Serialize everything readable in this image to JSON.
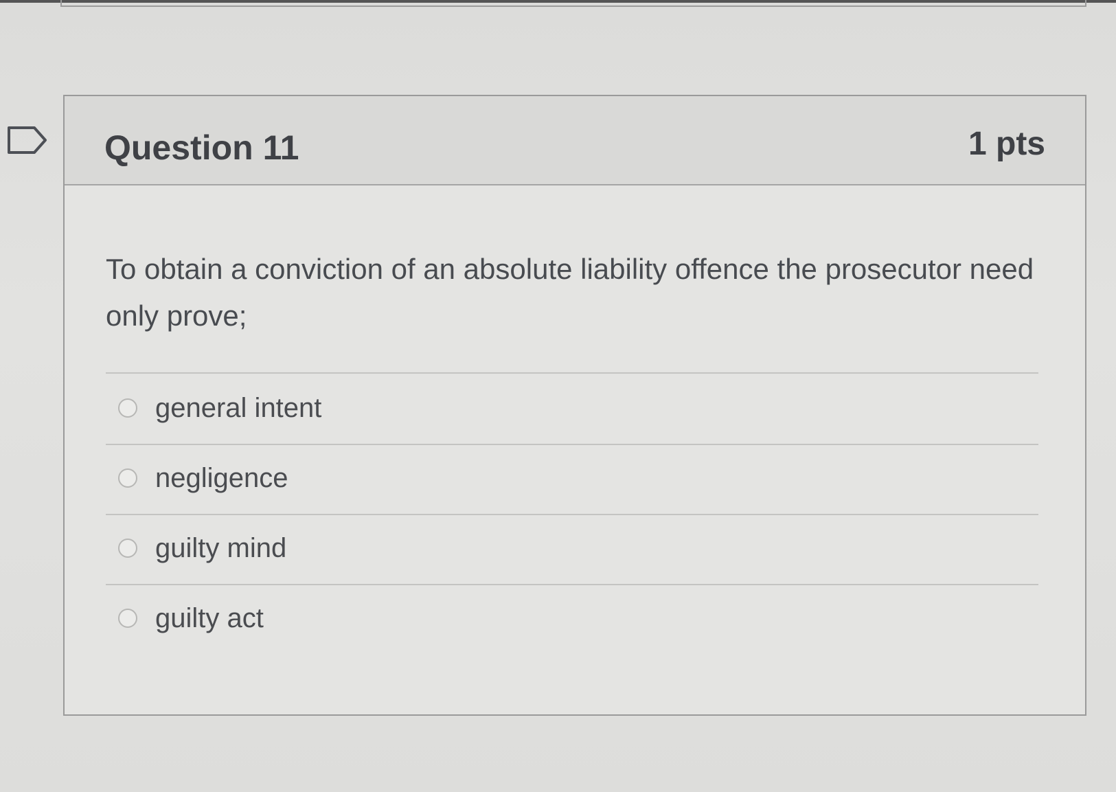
{
  "question": {
    "title": "Question 11",
    "points": "1 pts",
    "text": "To obtain a conviction of an absolute liability offence the prosecutor need only prove;",
    "flag_icon": "flag-outline-icon"
  },
  "answers": [
    {
      "label": "general intent",
      "selected": false
    },
    {
      "label": "negligence",
      "selected": false
    },
    {
      "label": "guilty mind",
      "selected": false
    },
    {
      "label": "guilty act",
      "selected": false
    }
  ]
}
